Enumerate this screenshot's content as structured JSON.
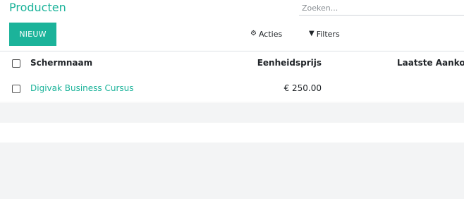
{
  "header": {
    "title": "Producten",
    "search_placeholder": "Zoeken..."
  },
  "toolbar": {
    "new_label": "NIEUW",
    "actions_label": "Acties",
    "filters_label": "Filters"
  },
  "table": {
    "columns": [
      "Schermnaam",
      "Eenheidsprijs",
      "Laatste Aanko"
    ],
    "rows": [
      {
        "name": "Digivak Business Cursus",
        "price": "€ 250.00"
      }
    ]
  },
  "colors": {
    "accent": "#1bb39a",
    "stripe": "#f3f4f5"
  },
  "icons": {
    "actions": "gear-icon",
    "filters": "filter-icon"
  }
}
